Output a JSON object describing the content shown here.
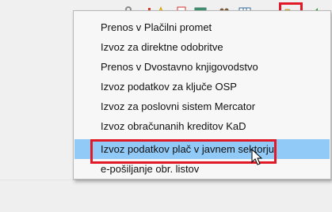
{
  "toolbar": {
    "icons": [
      "wrench-icon",
      "bar-chart-icon",
      "star-icon",
      "document-icon",
      "window-icon",
      "people-icon",
      "columns-icon",
      "export-folder-icon",
      "arrow-icon"
    ],
    "highlighted_icon": "export-folder-icon"
  },
  "menu": {
    "items": [
      {
        "label": "Prenos v Plačilni promet"
      },
      {
        "label": "Izvoz za direktne odobritve"
      },
      {
        "label": "Prenos v Dvostavno knjigovodstvo"
      },
      {
        "label": "Izvoz podatkov za ključe OSP"
      },
      {
        "label": "Izvoz za poslovni sistem Mercator"
      },
      {
        "label": "Izvoz obračunanih kreditov KaD"
      },
      {
        "label": "Izvoz podatkov plač v javnem sektorju"
      },
      {
        "label": "e-pošiljanje obr. listov"
      }
    ],
    "active_index": 6
  },
  "colors": {
    "highlight_red": "#e11826",
    "selection_blue": "#91c9f7",
    "menu_background": "#f7f7f7"
  }
}
